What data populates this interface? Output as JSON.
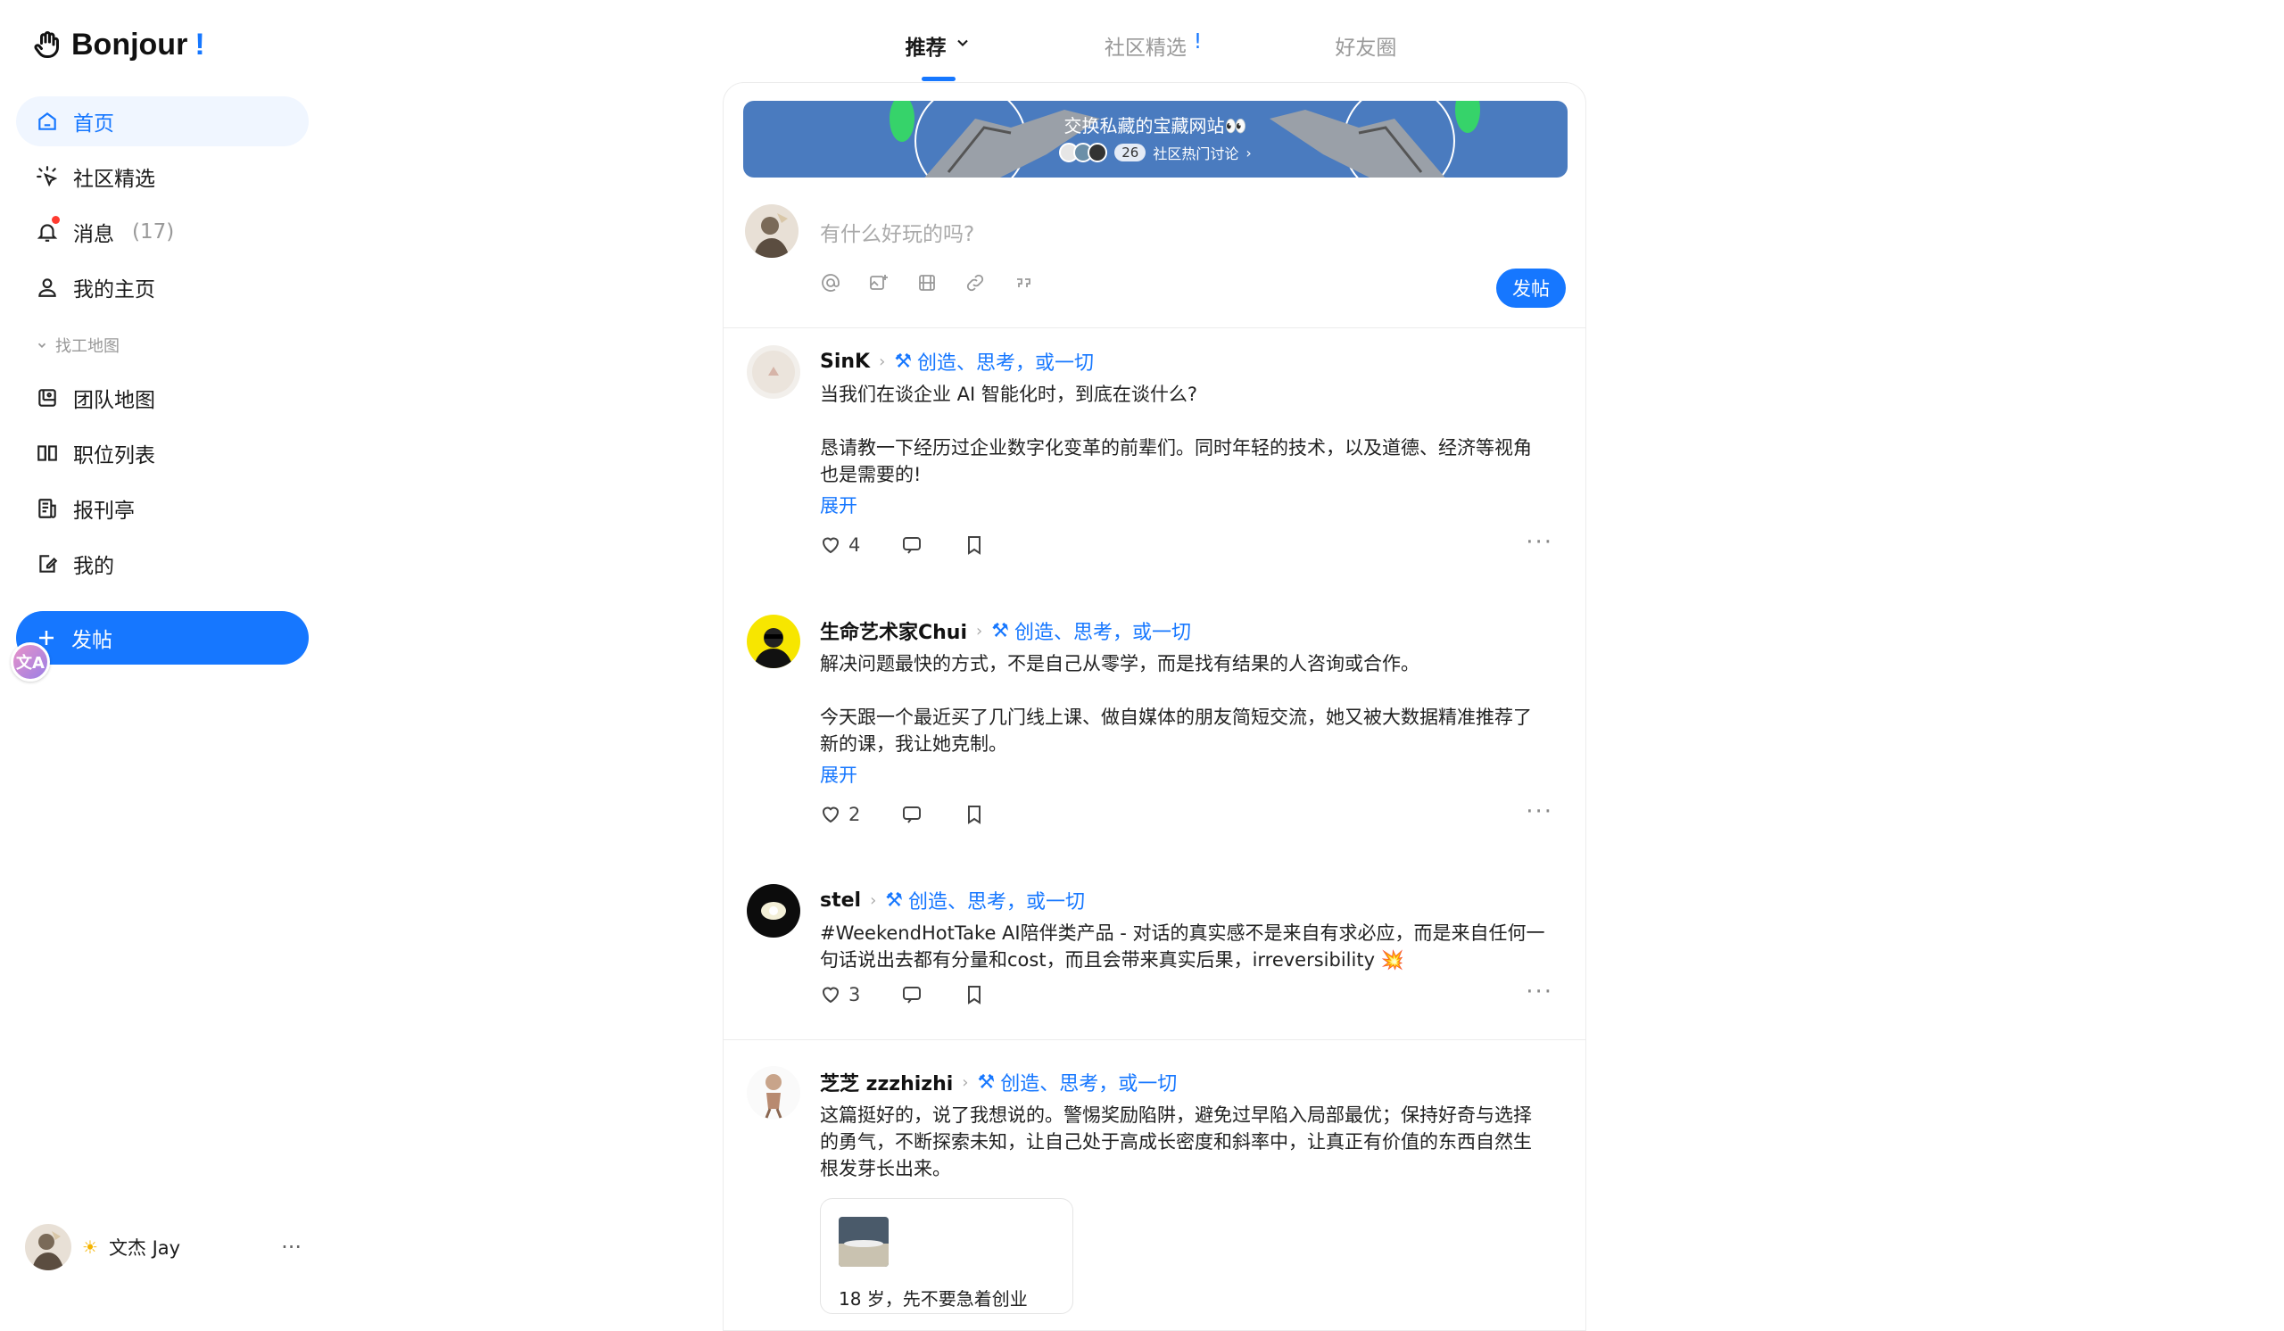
{
  "app": {
    "logo_text": "Bonjour",
    "logo_bang": "!"
  },
  "sidebar": {
    "items": [
      {
        "label": "首页",
        "icon": "home-icon"
      },
      {
        "label": "社区精选",
        "icon": "sparkle-icon"
      },
      {
        "label": "消息",
        "count": "(17)",
        "icon": "bell-icon"
      },
      {
        "label": "我的主页",
        "icon": "user-icon"
      }
    ],
    "group_label": "找工地图",
    "group_items": [
      {
        "label": "团队地图",
        "icon": "map-icon"
      },
      {
        "label": "职位列表",
        "icon": "book-icon"
      },
      {
        "label": "报刊亭",
        "icon": "newspaper-icon"
      },
      {
        "label": "我的",
        "icon": "edit-icon"
      }
    ],
    "post_button": "发帖",
    "user": {
      "name": "文杰 Jay",
      "more": "···"
    }
  },
  "tabs": [
    {
      "label": "推荐"
    },
    {
      "label": "社区精选",
      "mark": "!"
    },
    {
      "label": "好友圈"
    }
  ],
  "banner": {
    "title": "交换私藏的宝藏网站👀",
    "count": "26",
    "link": "社区热门讨论"
  },
  "composer": {
    "placeholder": "有什么好玩的吗?",
    "send_label": "发帖"
  },
  "posts": [
    {
      "author": "SinK",
      "topic": "创造、思考，或一切",
      "title": "当我们在谈企业 AI 智能化时，到底在谈什么?",
      "body_l1": "恳请教一下经历过企业数字化变革的前辈们。同时年轻的技术，以及道德、经济等视角",
      "body_l2": "也是需要的!",
      "expand": "展开",
      "likes": "4"
    },
    {
      "author": "生命艺术家Chui",
      "topic": "创造、思考，或一切",
      "title": "解决问题最快的方式，不是自己从零学，而是找有结果的人咨询或合作。",
      "body_l1": "今天跟一个最近买了几门线上课、做自媒体的朋友简短交流，她又被大数据精准推荐了",
      "body_l2": "新的课，我让她克制。",
      "expand": "展开",
      "likes": "2"
    },
    {
      "author": "stel",
      "topic": "创造、思考，或一切",
      "body_l1": "#WeekendHotTake AI陪伴类产品 - 对话的真实感不是来自有求必应，而是来自任何一",
      "body_l2": "句话说出去都有分量和cost，而且会带来真实后果，irreversibility 💥",
      "likes": "3"
    },
    {
      "author": "芝芝 zzzhizhi",
      "topic": "创造、思考，或一切",
      "body_l1": "这篇挺好的，说了我想说的。警惕奖励陷阱，避免过早陷入局部最优；保持好奇与选择",
      "body_l2": "的勇气，不断探索未知，让自己处于高成长密度和斜率中，让真正有价值的东西自然生",
      "body_l3": "根发芽长出来。",
      "card_text": "18 岁，先不要急着创业"
    }
  ]
}
